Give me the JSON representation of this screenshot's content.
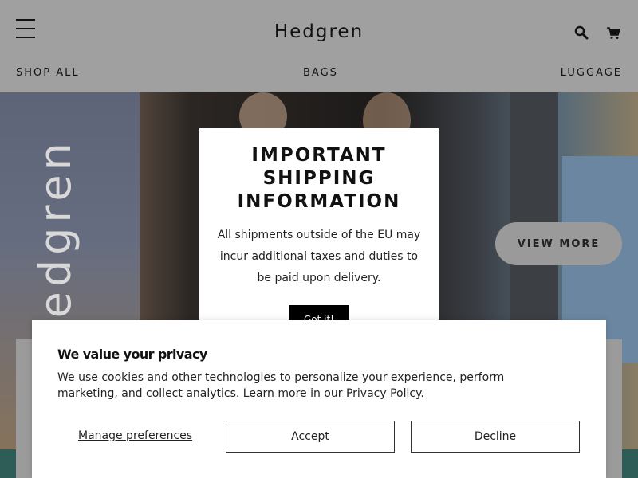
{
  "header": {
    "logo": "Hedgren",
    "nav": [
      "SHOP ALL",
      "BAGS",
      "LUGGAGE"
    ],
    "icons": [
      "menu-icon",
      "search-icon",
      "cart-icon"
    ]
  },
  "hero": {
    "view_more_label": "VIEW MORE"
  },
  "shipping_modal": {
    "title": "IMPORTANT SHIPPING INFORMATION",
    "text": "All shipments outside of the EU may incur additional taxes and duties to be paid upon delivery.",
    "button_label": "Got it!"
  },
  "cookie_banner": {
    "title": "We value your privacy",
    "text": "We use cookies and other technologies to personalize your experience, perform marketing, and collect analytics. Learn more in our",
    "link_label": "Privacy Policy.",
    "manage_label": "Manage preferences",
    "accept_label": "Accept",
    "decline_label": "Decline"
  },
  "colors": {
    "modal_bg": "#ffffff",
    "button_dark": "#000000",
    "text": "#222222",
    "teal": "#2e5c56"
  }
}
